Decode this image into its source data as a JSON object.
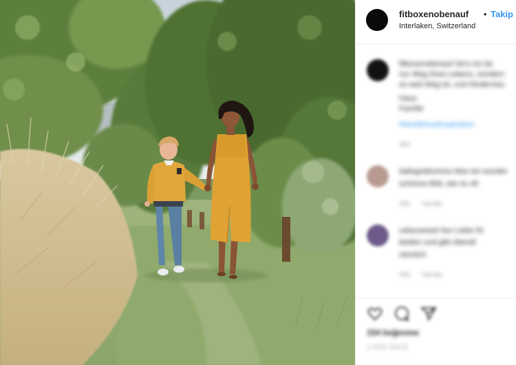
{
  "post": {
    "username": "fitboxenobenauf",
    "separator": "•",
    "follow_label": "Takip Et",
    "location": "Interlaken, Switzerland"
  },
  "comments": [
    {
      "author": "fitboxenobenauf",
      "lines": [
        "fitboxenobenauf Sirro ist nie",
        "nur Weg ihres Lebens, sondern",
        "so weit Weg ist, und Hinderniss",
        "Haus",
        "Familie"
      ],
      "tags": "#familiehuetinspiration",
      "time": "35h",
      "avatar_color": "#111111"
    },
    {
      "author": "ladiegoldiumina",
      "lines": [
        "ladiegoldiumina Was ein wunder",
        "schönes Bild, wie so oft"
      ],
      "time": "35h",
      "reply_label": "Yanıtla",
      "avatar_color": "#b89a90"
    },
    {
      "author": "ceboramest",
      "lines": [
        "ceboramest Nur Liebe ihr",
        "beiden und gibt überall",
        "ziemlich"
      ],
      "time": "35h",
      "reply_label": "Yanıtla",
      "avatar_color": "#6d5a8a"
    }
  ],
  "footer": {
    "likes": "154 beğenme",
    "date": "1 GÜN ÖNCE"
  },
  "icons": {
    "like": "heart-icon",
    "comment": "comment-icon",
    "share": "share-icon"
  },
  "colors": {
    "link": "#3897f0",
    "text": "#262626",
    "muted": "#999999"
  }
}
